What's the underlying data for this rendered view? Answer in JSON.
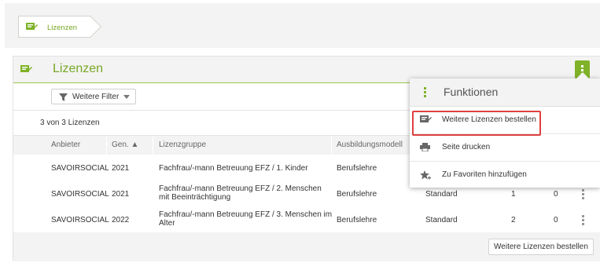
{
  "breadcrumb": {
    "label": "Lizenzen",
    "icon": "license-icon"
  },
  "panel": {
    "title": "Lizenzen",
    "filter_label": "Weitere Filter",
    "count_text": "3 von 3 Lizenzen",
    "columns": [
      "Anbieter",
      "Gen. ▲",
      "Lizenzgruppe",
      "Ausbildungsmodell"
    ],
    "rows": [
      {
        "anbieter": "SAVOIRSOCIAL",
        "gen": "2021",
        "gruppe": "Fachfrau/-mann Betreuung EFZ / 1. Kinder",
        "modell": "Berufslehre",
        "typ": "",
        "n1": "",
        "n2": ""
      },
      {
        "anbieter": "SAVOIRSOCIAL",
        "gen": "2021",
        "gruppe": "Fachfrau/-mann Betreuung EFZ / 2. Menschen mit Beeinträchtigung",
        "modell": "Berufslehre",
        "typ": "Standard",
        "n1": "1",
        "n2": "0"
      },
      {
        "anbieter": "SAVOIRSOCIAL",
        "gen": "2022",
        "gruppe": "Fachfrau/-mann Betreuung EFZ / 3. Menschen im Alter",
        "modell": "Berufslehre",
        "typ": "Standard",
        "n1": "2",
        "n2": "0"
      }
    ],
    "footer_button": "Weitere Lizenzen bestellen"
  },
  "menu": {
    "title": "Funktionen",
    "items": [
      {
        "label": "Weitere Lizenzen bestellen",
        "icon": "license-order-icon"
      },
      {
        "label": "Seite drucken",
        "icon": "printer-icon"
      },
      {
        "label": "Zu Favoriten hinzufügen",
        "icon": "star-add-icon"
      }
    ]
  },
  "colors": {
    "accent": "#77a826",
    "button_green": "#7fb228",
    "highlight": "#e04040"
  }
}
